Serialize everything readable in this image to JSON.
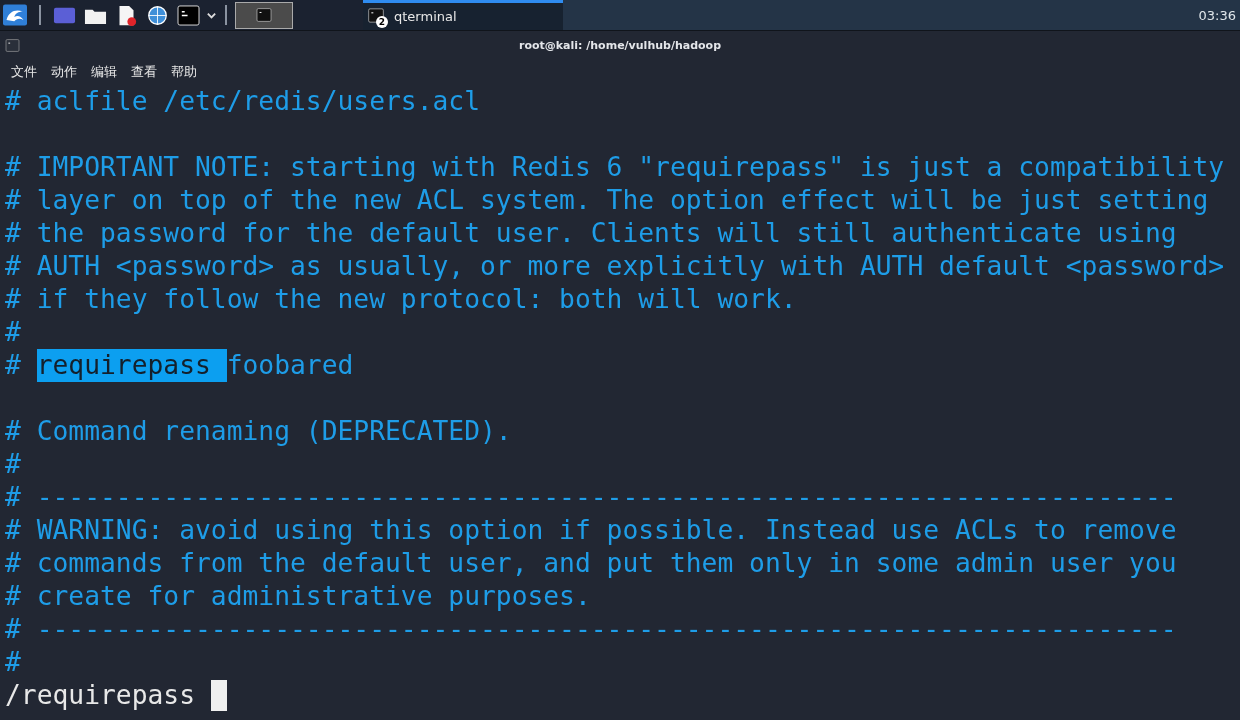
{
  "taskbar": {
    "launchers": [
      {
        "kind": "kali"
      },
      {
        "kind": "workspace"
      },
      {
        "kind": "folder"
      },
      {
        "kind": "editor"
      },
      {
        "kind": "browser"
      },
      {
        "kind": "terminal"
      },
      {
        "kind": "chevron"
      }
    ],
    "workspace": {
      "selected": true
    },
    "tasks": [
      {
        "title": "qterminal",
        "badge": "2",
        "selected": true
      }
    ],
    "clock": "03:36"
  },
  "window": {
    "title": "root@kali: /home/vulhub/hadoop"
  },
  "menu": [
    "文件",
    "动作",
    "编辑",
    "查看",
    "帮助"
  ],
  "blocks": [
    {
      "lines": [
        {
          "segments": [
            {
              "text": "# aclfile /etc/redis/users.acl",
              "highlighted": false
            }
          ]
        }
      ]
    },
    {
      "lines": [
        {
          "segments": [
            {
              "text": "# IMPORTANT NOTE: starting with Redis 6 \"requirepass\" is just a compatibility",
              "highlighted": false
            }
          ]
        },
        {
          "segments": [
            {
              "text": "# layer on top of the new ACL system. The option effect will be just setting",
              "highlighted": false
            }
          ]
        },
        {
          "segments": [
            {
              "text": "# the password for the default user. Clients will still authenticate using",
              "highlighted": false
            }
          ]
        },
        {
          "segments": [
            {
              "text": "# AUTH <password> as usually, or more explicitly with AUTH default <password>",
              "highlighted": false
            }
          ]
        },
        {
          "segments": [
            {
              "text": "# if they follow the new protocol: both will work.",
              "highlighted": false
            }
          ]
        },
        {
          "segments": [
            {
              "text": "#",
              "highlighted": false
            }
          ]
        },
        {
          "segments": [
            {
              "text": "# ",
              "highlighted": false
            },
            {
              "text": "requirepass ",
              "highlighted": true
            },
            {
              "text": "foobared",
              "highlighted": false
            }
          ]
        }
      ]
    },
    {
      "lines": [
        {
          "segments": [
            {
              "text": "# Command renaming (DEPRECATED).",
              "highlighted": false
            }
          ]
        },
        {
          "segments": [
            {
              "text": "#",
              "highlighted": false
            }
          ]
        },
        {
          "segments": [
            {
              "text": "# ------------------------------------------------------------------------",
              "highlighted": false
            }
          ]
        },
        {
          "segments": [
            {
              "text": "# WARNING: avoid using this option if possible. Instead use ACLs to remove",
              "highlighted": false
            }
          ]
        },
        {
          "segments": [
            {
              "text": "# commands from the default user, and put them only in some admin user you",
              "highlighted": false
            }
          ]
        },
        {
          "segments": [
            {
              "text": "# create for administrative purposes.",
              "highlighted": false
            }
          ]
        },
        {
          "segments": [
            {
              "text": "# ------------------------------------------------------------------------",
              "highlighted": false
            }
          ]
        },
        {
          "segments": [
            {
              "text": "#",
              "highlighted": false
            }
          ]
        }
      ]
    }
  ],
  "command_line": {
    "text": "/requirepass"
  }
}
